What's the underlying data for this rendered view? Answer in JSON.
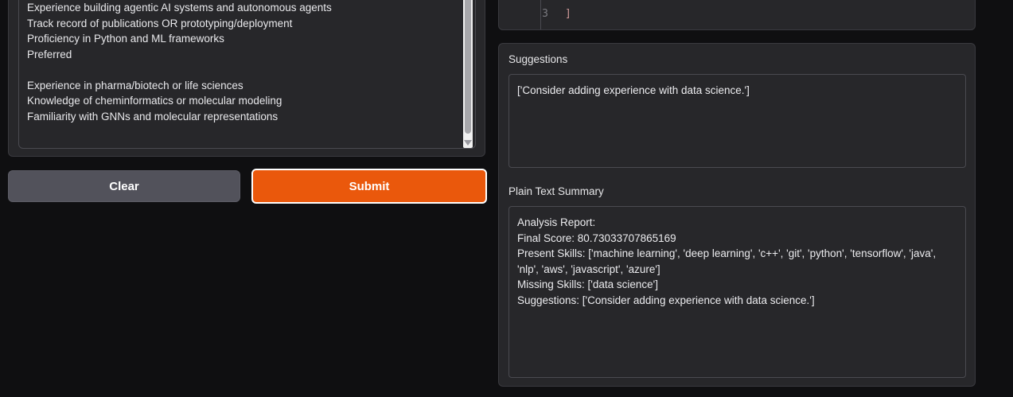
{
  "job_description": {
    "lines": [
      "Experience building agentic AI systems and autonomous agents",
      "Track record of publications OR prototyping/deployment",
      "Proficiency in Python and ML frameworks",
      "Preferred",
      "",
      "Experience in pharma/biotech or life sciences",
      "Knowledge of cheminformatics or molecular modeling",
      "Familiarity with GNNs and molecular representations"
    ]
  },
  "buttons": {
    "clear_label": "Clear",
    "submit_label": "Submit"
  },
  "code_block": {
    "visible_line_number": "3",
    "visible_line_text": "]"
  },
  "suggestions": {
    "label": "Suggestions",
    "value": "['Consider adding experience with data science.']"
  },
  "summary": {
    "label": "Plain Text Summary",
    "lines": [
      "Analysis Report:",
      "Final Score: 80.73033707865169",
      "Present Skills: ['machine learning', 'deep learning', 'c++', 'git', 'python', 'tensorflow', 'java', 'nlp', 'aws', 'javascript', 'azure']",
      "Missing Skills: ['data science']",
      "Suggestions: ['Consider adding experience with data science.']"
    ]
  },
  "colors": {
    "background": "#0f0f11",
    "panel": "#27272a",
    "accent": "#ea580c",
    "secondary_button": "#52525b"
  }
}
